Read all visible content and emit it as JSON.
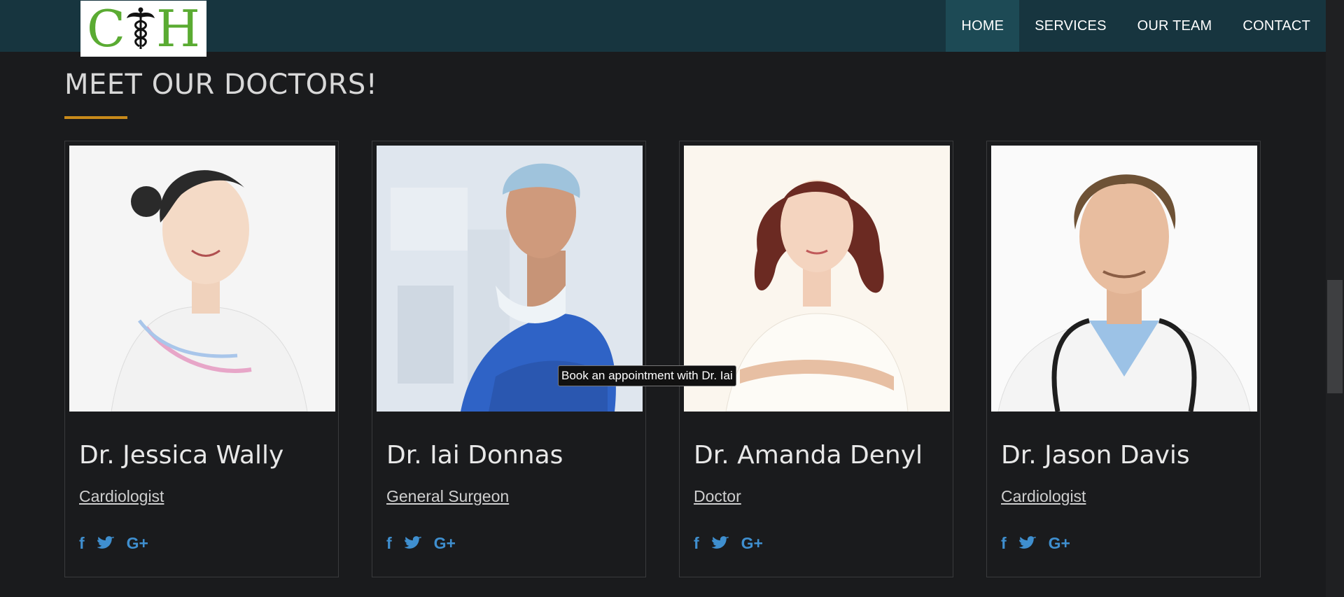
{
  "logo": {
    "letter_left": "C",
    "letter_right": "H",
    "icon": "caduceus-icon"
  },
  "nav": {
    "items": [
      {
        "label": "HOME",
        "active": true
      },
      {
        "label": "SERVICES",
        "active": false
      },
      {
        "label": "OUR TEAM",
        "active": false
      },
      {
        "label": "CONTACT",
        "active": false
      }
    ]
  },
  "section": {
    "title": "MEET OUR DOCTORS!"
  },
  "doctors": [
    {
      "name": "Dr. Jessica Wally",
      "role": "Cardiologist",
      "photo": "doctor-photo-jessica"
    },
    {
      "name": "Dr. Iai Donnas",
      "role": "General Surgeon",
      "photo": "doctor-photo-iai"
    },
    {
      "name": "Dr. Amanda Denyl",
      "role": "Doctor",
      "photo": "doctor-photo-amanda"
    },
    {
      "name": "Dr. Jason Davis",
      "role": "Cardiologist",
      "photo": "doctor-photo-jason"
    }
  ],
  "social": {
    "facebook": "f",
    "twitter": "twitter-bird-icon",
    "google": "G+"
  },
  "tooltip": {
    "text": "Book an appointment with Dr. Iai"
  },
  "colors": {
    "accent": "#c88a1a",
    "navbar": "#17353f",
    "nav_active": "#1d4a55",
    "social": "#3f8fcf",
    "logo_green": "#5aab32"
  }
}
